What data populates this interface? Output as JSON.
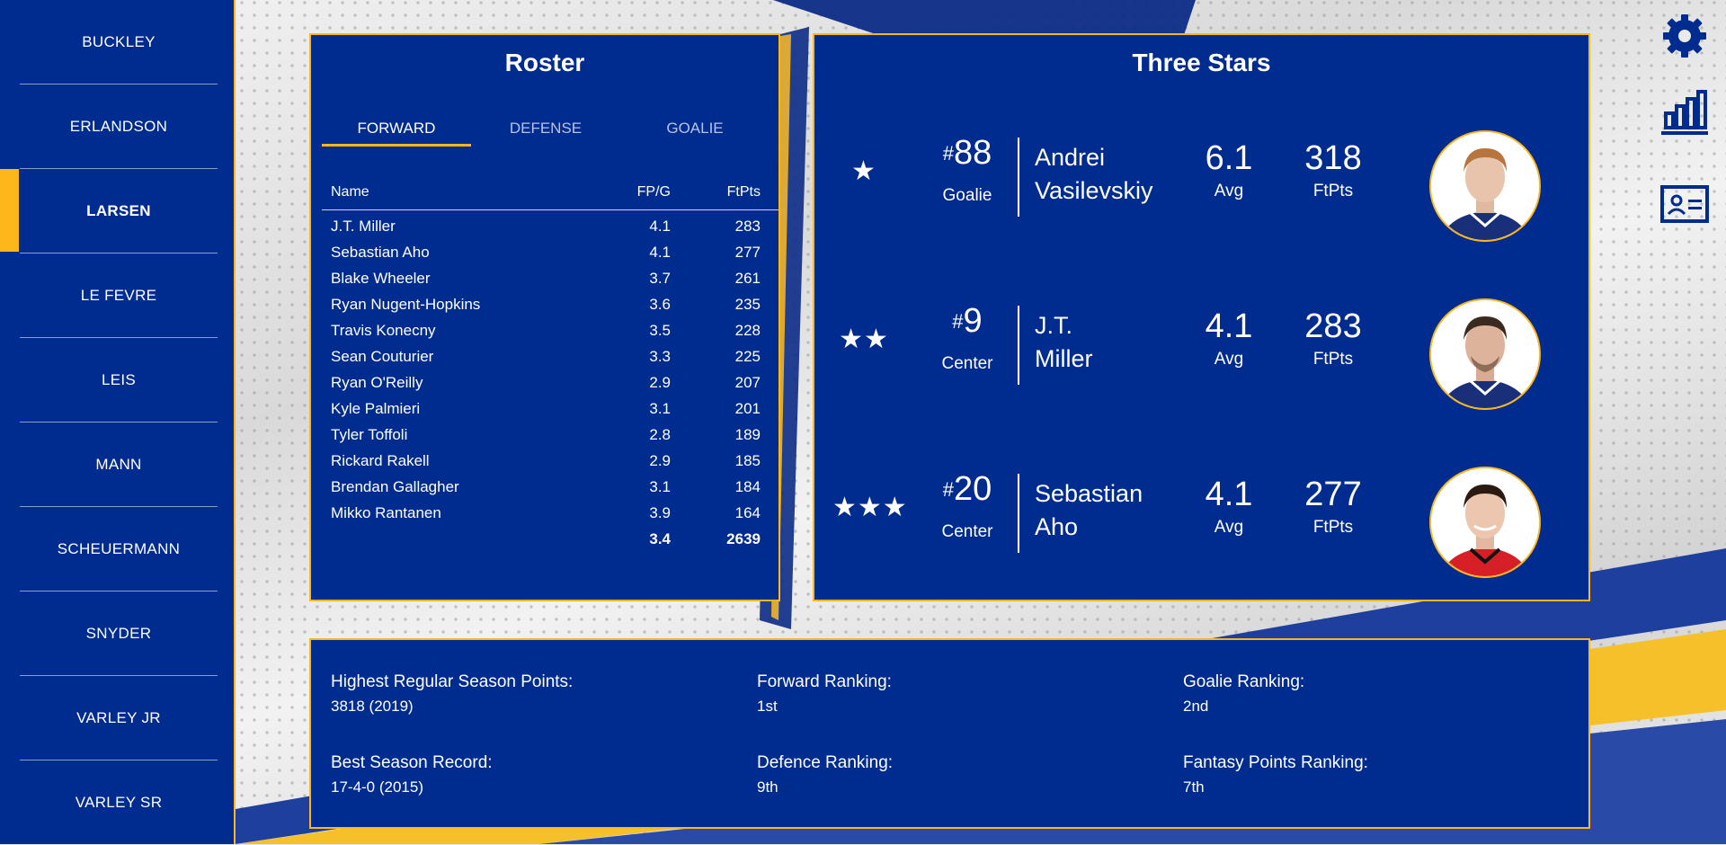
{
  "sidebar": {
    "items": [
      {
        "label": "BUCKLEY"
      },
      {
        "label": "ERLANDSON"
      },
      {
        "label": "LARSEN"
      },
      {
        "label": "LE FEVRE"
      },
      {
        "label": "LEIS"
      },
      {
        "label": "MANN"
      },
      {
        "label": "SCHEUERMANN"
      },
      {
        "label": "SNYDER"
      },
      {
        "label": "VARLEY JR"
      },
      {
        "label": "VARLEY SR"
      }
    ],
    "active": "LARSEN"
  },
  "roster": {
    "title": "Roster",
    "tabs": [
      {
        "label": "FORWARD"
      },
      {
        "label": "DEFENSE"
      },
      {
        "label": "GOALIE"
      }
    ],
    "columns": {
      "name": "Name",
      "fpg": "FP/G",
      "ftpts": "FtPts"
    },
    "rows": [
      {
        "name": "J.T. Miller",
        "fpg": "4.1",
        "ftpts": "283"
      },
      {
        "name": "Sebastian Aho",
        "fpg": "4.1",
        "ftpts": "277"
      },
      {
        "name": "Blake Wheeler",
        "fpg": "3.7",
        "ftpts": "261"
      },
      {
        "name": "Ryan Nugent-Hopkins",
        "fpg": "3.6",
        "ftpts": "235"
      },
      {
        "name": "Travis Konecny",
        "fpg": "3.5",
        "ftpts": "228"
      },
      {
        "name": "Sean Couturier",
        "fpg": "3.3",
        "ftpts": "225"
      },
      {
        "name": "Ryan O'Reilly",
        "fpg": "2.9",
        "ftpts": "207"
      },
      {
        "name": "Kyle Palmieri",
        "fpg": "3.1",
        "ftpts": "201"
      },
      {
        "name": "Tyler Toffoli",
        "fpg": "2.8",
        "ftpts": "189"
      },
      {
        "name": "Rickard Rakell",
        "fpg": "2.9",
        "ftpts": "185"
      },
      {
        "name": "Brendan Gallagher",
        "fpg": "3.1",
        "ftpts": "184"
      },
      {
        "name": "Mikko Rantanen",
        "fpg": "3.9",
        "ftpts": "164"
      }
    ],
    "total": {
      "fpg": "3.4",
      "ftpts": "2639"
    }
  },
  "three_stars": {
    "title": "Three Stars",
    "players": [
      {
        "stars": "★",
        "hash": "#",
        "number": "88",
        "position": "Goalie",
        "first": "Andrei",
        "last": "Vasilevskiy",
        "avg": "6.1",
        "avg_label": "Avg",
        "ftpts": "318",
        "ftpts_label": "FtPts",
        "jersey": "#1a2f7a"
      },
      {
        "stars": "★★",
        "hash": "#",
        "number": "9",
        "position": "Center",
        "first": "J.T.",
        "last": "Miller",
        "avg": "4.1",
        "avg_label": "Avg",
        "ftpts": "283",
        "ftpts_label": "FtPts",
        "jersey": "#1a2f7a"
      },
      {
        "stars": "★★★",
        "hash": "#",
        "number": "20",
        "position": "Center",
        "first": "Sebastian",
        "last": "Aho",
        "avg": "4.1",
        "avg_label": "Avg",
        "ftpts": "277",
        "ftpts_label": "FtPts",
        "jersey": "#d61f26"
      }
    ]
  },
  "summary": {
    "highest_points": {
      "label": "Highest Regular Season Points:",
      "value": "3818 (2019)"
    },
    "forward_ranking": {
      "label": "Forward Ranking:",
      "value": "1st"
    },
    "goalie_ranking": {
      "label": "Goalie Ranking:",
      "value": "2nd"
    },
    "best_record": {
      "label": "Best Season Record:",
      "value": "17-4-0 (2015)"
    },
    "defence_ranking": {
      "label": "Defence Ranking:",
      "value": "9th"
    },
    "fantasy_ranking": {
      "label": "Fantasy Points Ranking:",
      "value": "7th"
    }
  },
  "icons": {
    "settings": "gear-icon",
    "stats": "bar-chart-icon",
    "profile": "id-card-icon"
  },
  "colors": {
    "navy": "#002B8F",
    "gold": "#FDB71A"
  }
}
